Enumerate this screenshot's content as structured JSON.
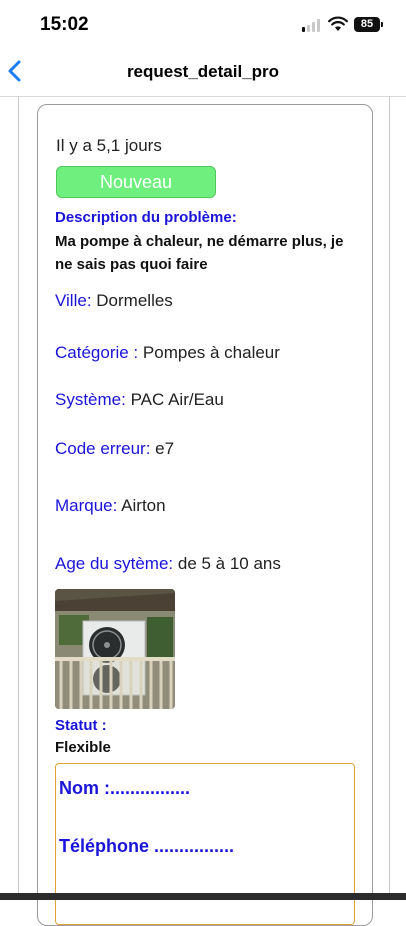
{
  "status_bar": {
    "time": "15:02",
    "battery": "85",
    "icons": [
      "signal-icon",
      "wifi-icon",
      "battery-icon"
    ]
  },
  "nav": {
    "title": "request_detail_pro",
    "back_icon": "chevron-left-icon"
  },
  "request": {
    "age": "Il y a 5,1  jours",
    "badge": "Nouveau",
    "description_label": "Description du problème:",
    "description": "Ma pompe à chaleur, ne démarre plus, je ne sais pas quoi faire",
    "fields": {
      "ville": {
        "label": "Ville:",
        "value": "Dormelles"
      },
      "categorie": {
        "label": "Catégorie :",
        "value": "Pompes à chaleur"
      },
      "systeme": {
        "label": "Système:",
        "value": "PAC Air/Eau"
      },
      "code_erreur": {
        "label": "Code erreur:",
        "value": "e7"
      },
      "marque": {
        "label": "Marque:",
        "value": "Airton"
      },
      "age_systeme": {
        "label": "Age du sytème:",
        "value": "de 5 à 10 ans"
      }
    },
    "statut_label": "Statut :",
    "statut_value": "Flexible",
    "contact": {
      "nom": "Nom :................",
      "telephone": "Téléphone ................"
    }
  },
  "colors": {
    "label_blue": "#1a14d8",
    "badge_green": "#6fef7d",
    "contact_border": "#e0a23a",
    "back_blue": "#1a7cf5"
  }
}
